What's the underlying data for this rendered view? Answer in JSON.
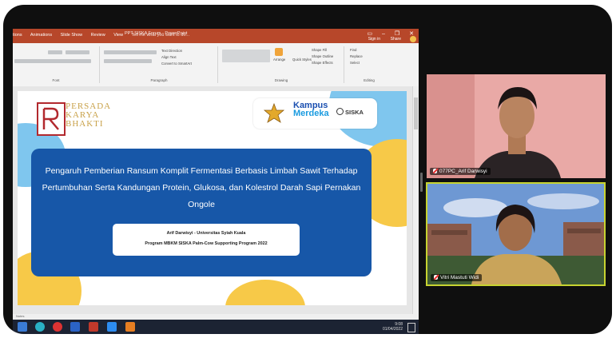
{
  "window": {
    "title": "PPT SISKA Forum - PowerPoint",
    "tabs": [
      "tions",
      "Animations",
      "Slide Show",
      "Review",
      "View"
    ],
    "tell_me": "Tell me what you want to do...",
    "sign_in": "Sign in",
    "share": "Share",
    "controls": [
      "▭",
      "–",
      "❐",
      "✕"
    ]
  },
  "ribbon": {
    "groups": [
      "Font",
      "Paragraph",
      "Drawing",
      "Editing"
    ],
    "text_direction": "Text Direction",
    "align_text": "Align Text",
    "convert_smartart": "Convert to SmartArt",
    "arrange": "Arrange",
    "quick_styles": "Quick Styles",
    "shape_fill": "Shape Fill",
    "shape_outline": "Shape Outline",
    "shape_effects": "Shape Effects",
    "find": "Find",
    "replace": "Replace",
    "select": "Select"
  },
  "slide": {
    "logo_left_lines": [
      "PERSADA",
      "KARYA",
      "BHAKTI"
    ],
    "kampus_line1": "Kampus",
    "kampus_line2": "Merdeka",
    "siska_logo": "SISKA",
    "title": "Pengaruh Pemberian Ransum Komplit Fermentasi Berbasis Limbah Sawit Terhadap Pertumbuhan Serta Kandungan Protein, Glukosa, dan Kolestrol Darah Sapi Pernakan Ongole",
    "author": "Arif Darwisyi - Universitas Syiah Kuala",
    "program": "Program MBKM SISKA Palm-Cow Supporting Program 2022",
    "colors": {
      "blue_card": "#1757a8",
      "yellow": "#f7c948",
      "sky": "#7fc6ee"
    }
  },
  "statusbar": {
    "notes": "Notes"
  },
  "taskbar": {
    "time": "9:08",
    "date": "01/04/2022"
  },
  "participants": [
    {
      "name": "077PC_Arif Darwisyi",
      "muted": true
    },
    {
      "name": "Vitri Mastuti Widi",
      "muted": true
    }
  ]
}
